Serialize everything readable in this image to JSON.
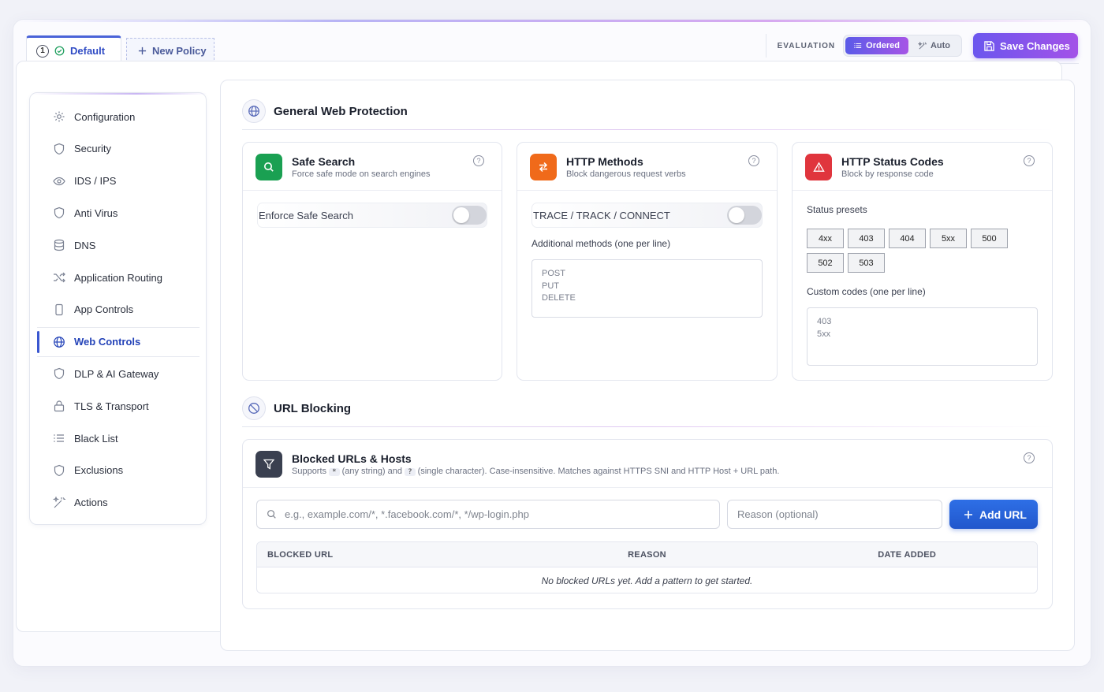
{
  "header": {
    "tabs": [
      {
        "number": "1",
        "label": "Default",
        "active": true
      },
      {
        "label": "New Policy",
        "active": false
      }
    ],
    "evaluation_label": "EVALUATION",
    "evaluation_modes": [
      "Ordered",
      "Auto"
    ],
    "evaluation_selected": "Ordered",
    "save_label": "Save Changes"
  },
  "sidebar": {
    "items": [
      {
        "label": "Configuration",
        "icon": "gear-icon"
      },
      {
        "label": "Security",
        "icon": "shield-icon"
      },
      {
        "label": "IDS / IPS",
        "icon": "eye-icon"
      },
      {
        "label": "Anti Virus",
        "icon": "shield-icon"
      },
      {
        "label": "DNS",
        "icon": "database-icon"
      },
      {
        "label": "Application Routing",
        "icon": "shuffle-icon"
      },
      {
        "label": "App Controls",
        "icon": "smartphone-icon"
      },
      {
        "label": "Web Controls",
        "icon": "globe-icon",
        "active": true
      },
      {
        "label": "DLP & AI Gateway",
        "icon": "shield-icon"
      },
      {
        "label": "TLS & Transport",
        "icon": "lock-icon"
      },
      {
        "label": "Black List",
        "icon": "list-icon"
      },
      {
        "label": "Exclusions",
        "icon": "shield-icon"
      },
      {
        "label": "Actions",
        "icon": "wand-icon"
      }
    ]
  },
  "general": {
    "title": "General Web Protection",
    "safe_search": {
      "title": "Safe Search",
      "subtitle": "Force safe mode on search engines",
      "toggle_label": "Enforce Safe Search",
      "enabled": false
    },
    "http_methods": {
      "title": "HTTP Methods",
      "subtitle": "Block dangerous request verbs",
      "toggle_label": "TRACE / TRACK / CONNECT",
      "enabled": false,
      "additional_label": "Additional methods (one per line)",
      "additional_placeholder": "POST\nPUT\nDELETE"
    },
    "http_status": {
      "title": "HTTP Status Codes",
      "subtitle": "Block by response code",
      "presets_label": "Status presets",
      "presets": [
        "4xx",
        "403",
        "404",
        "5xx",
        "500",
        "502",
        "503"
      ],
      "custom_label": "Custom codes (one per line)",
      "custom_placeholder": "403\n5xx"
    }
  },
  "url_blocking": {
    "title": "URL Blocking",
    "card_title": "Blocked URLs & Hosts",
    "sub_supports": "Supports",
    "sub_star": "*",
    "sub_any": "(any string) and",
    "sub_q": "?",
    "sub_rest": "(single character). Case-insensitive. Matches against HTTPS SNI and HTTP Host + URL path.",
    "url_placeholder": "e.g., example.com/*, *.facebook.com/*, */wp-login.php",
    "reason_placeholder": "Reason (optional)",
    "add_label": "Add URL",
    "columns": [
      "BLOCKED URL",
      "REASON",
      "DATE ADDED"
    ],
    "empty_text": "No blocked URLs yet. Add a pattern to get started."
  },
  "colors": {
    "accent": "#3a57d0",
    "purple_gradient_start": "#6b56ee",
    "purple_gradient_end": "#a352e8",
    "safe_search": "#1aa052",
    "http_methods": "#f06a1a",
    "http_status": "#e0353d",
    "url_blocking": "#3a4050",
    "add_button": "#2563d8"
  }
}
